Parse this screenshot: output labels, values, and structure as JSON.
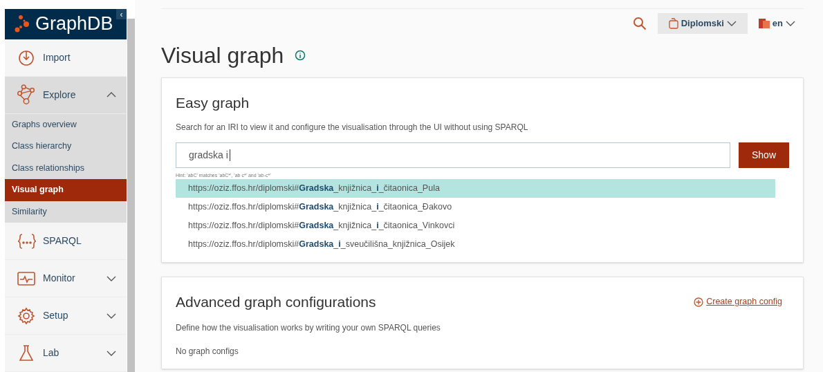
{
  "sidebar": {
    "logo": "GraphDB",
    "collapse_glyph": "‹",
    "items": [
      {
        "kind": "item",
        "label": "Import",
        "expanded": false
      },
      {
        "kind": "group",
        "label": "Explore",
        "expanded": true,
        "children": [
          {
            "label": "Graphs overview",
            "selected": false
          },
          {
            "label": "Class hierarchy",
            "selected": false
          },
          {
            "label": "Class relationships",
            "selected": false
          },
          {
            "label": "Visual graph",
            "selected": true
          },
          {
            "label": "Similarity",
            "selected": false
          }
        ]
      },
      {
        "kind": "item",
        "label": "SPARQL",
        "expanded": false
      },
      {
        "kind": "group",
        "label": "Monitor",
        "expanded": false
      },
      {
        "kind": "group",
        "label": "Setup",
        "expanded": false
      },
      {
        "kind": "group",
        "label": "Lab",
        "expanded": false
      }
    ]
  },
  "topbar": {
    "repository": "Diplomski",
    "language": "en"
  },
  "page": {
    "title": "Visual graph"
  },
  "easy_graph": {
    "title": "Easy graph",
    "description": "Search for an IRI to view it and configure the visualisation through the UI without using SPARQL",
    "search_value": "gradska i",
    "button": "Show",
    "hint": "Hint: 'abC' matches 'abC*', 'ab c*' and 'ab-c*'",
    "suggestions": [
      {
        "text": "https://oziz.ffos.hr/diplomski#**Gradska**_knjižnica_**i**_čitaonica_Pula",
        "selected": true
      },
      {
        "text": "https://oziz.ffos.hr/diplomski#**Gradska**_knjižnica_**i**_čitaonica_Đakovo",
        "selected": false
      },
      {
        "text": "https://oziz.ffos.hr/diplomski#**Gradska**_knjižnica_**i**_čitaonica_Vinkovci",
        "selected": false
      },
      {
        "text": "https://oziz.ffos.hr/diplomski#**Gradska**_**i**_sveučilišna_knjižnica_Osijek",
        "selected": false
      }
    ]
  },
  "advanced": {
    "title": "Advanced graph configurations",
    "create_link": "Create graph config",
    "description": "Define how the visualisation works by writing your own SPARQL queries",
    "empty": "No graph configs"
  }
}
